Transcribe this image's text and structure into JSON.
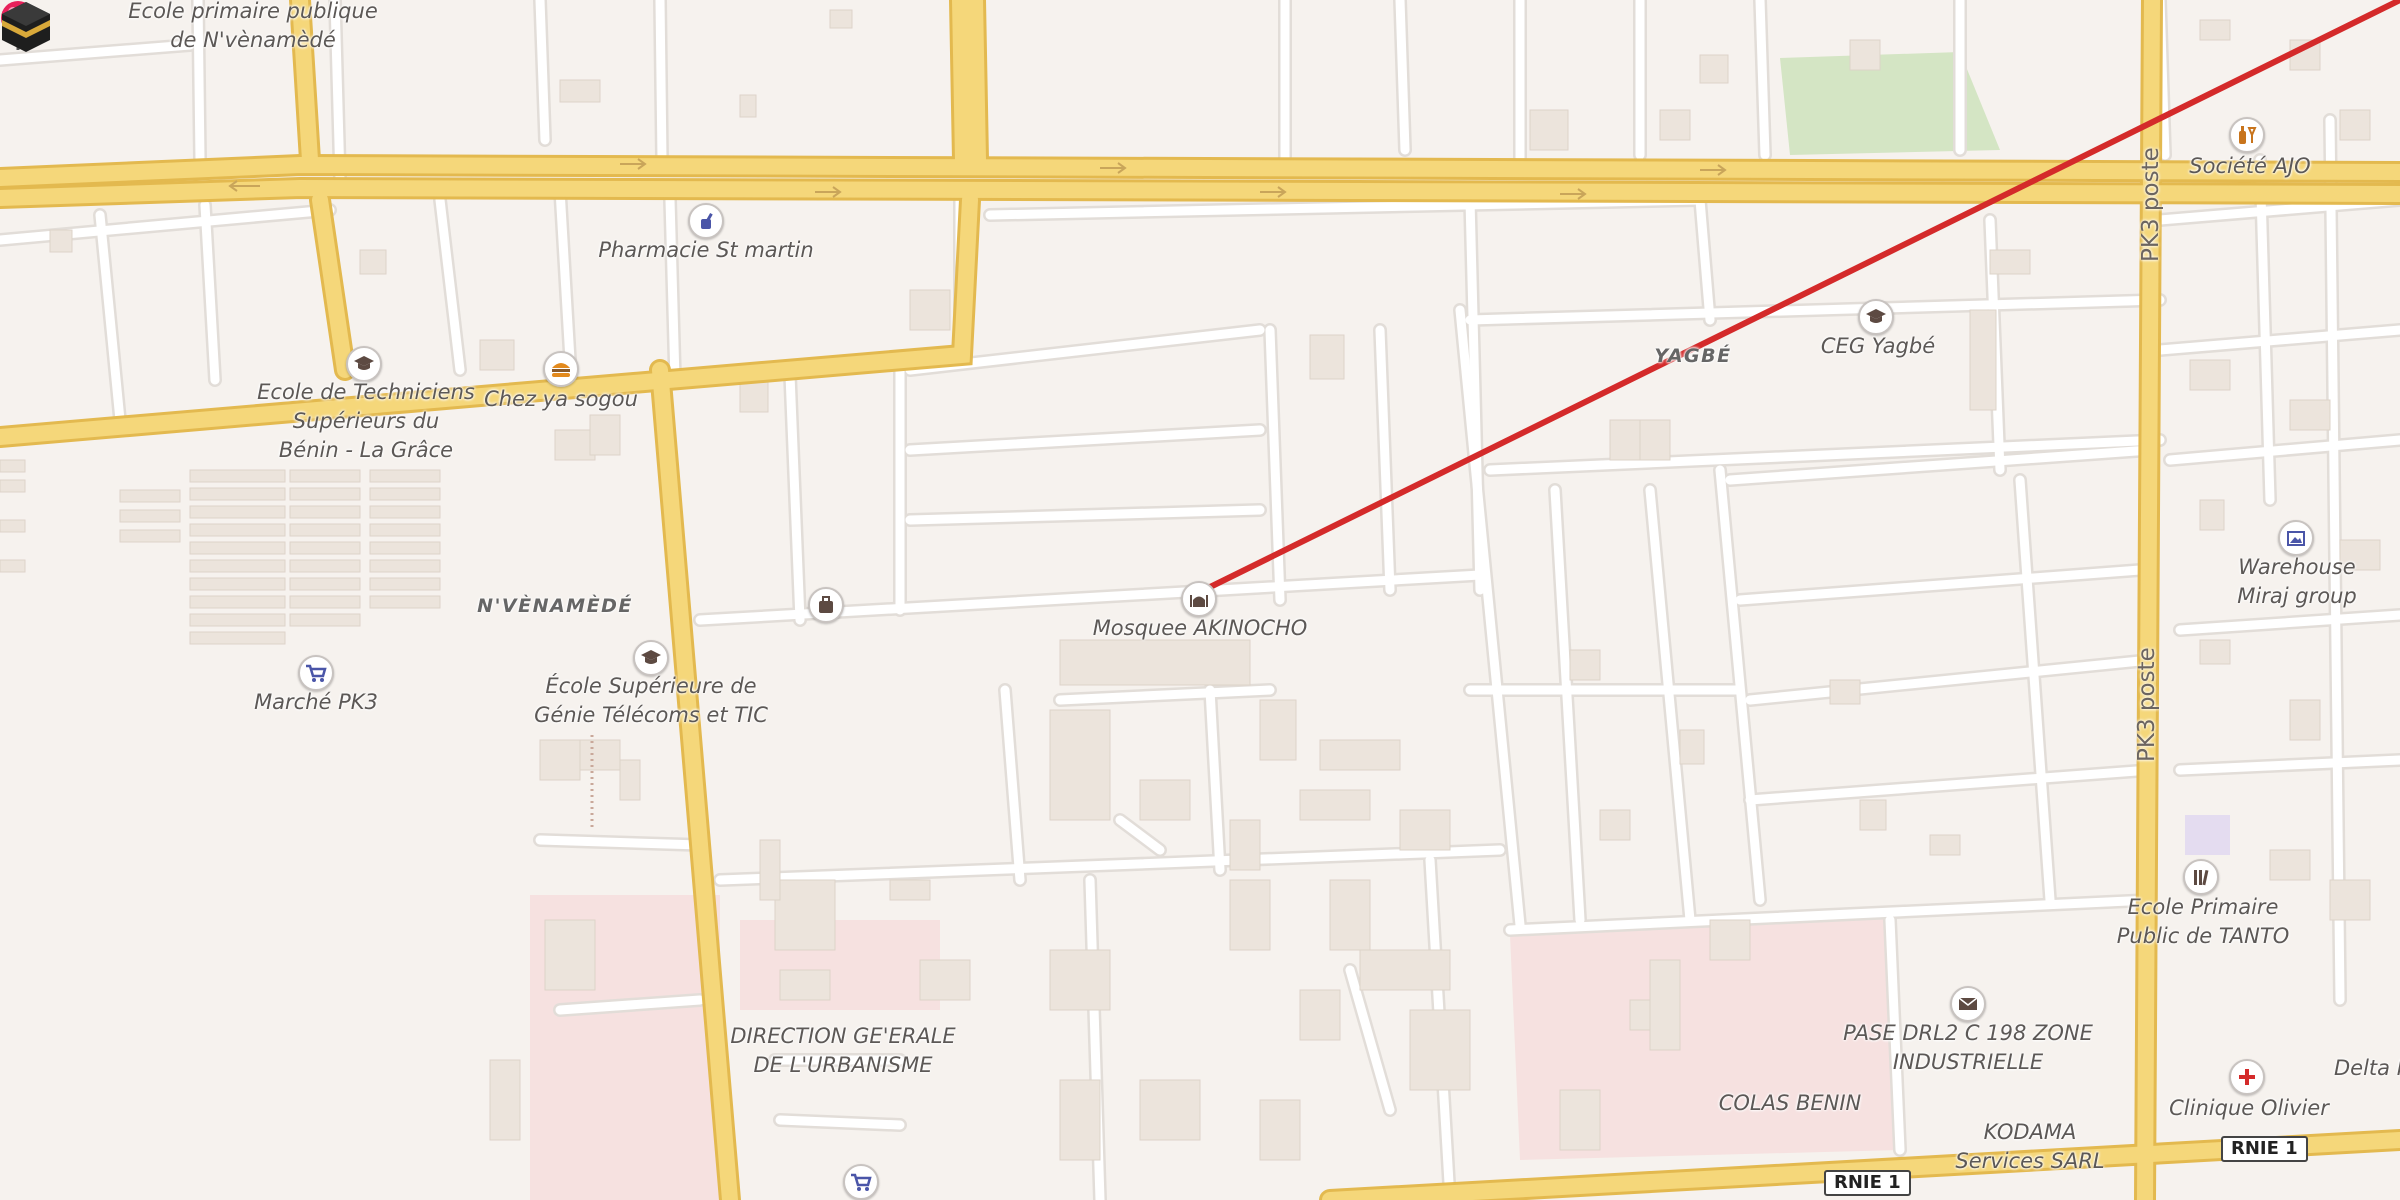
{
  "colors": {
    "background": "#f6f2ee",
    "road_major": "#f5d77a",
    "road_casing": "#e3b94f",
    "road_minor": "#ffffff",
    "building": "#ece4dc",
    "line": "#d42a2a",
    "pin": "#e8215b",
    "park": "#d4e5c4",
    "zone_red": "#f6e1e0"
  },
  "place_labels": [
    {
      "text": "Ecole primaire publique\nde N'vènamèdé"
    },
    {
      "text": "Pharmacie St martin"
    },
    {
      "text": "Ecole de Techniciens\nSupérieurs du\nBénin - La Grâce"
    },
    {
      "text": "Chez ya sogou"
    },
    {
      "text": "N'VÈNAMÈDÉ"
    },
    {
      "text": "École Supérieure de\nGénie Télécoms et TIC"
    },
    {
      "text": "Marché PK3"
    },
    {
      "text": "Mosquee AKINOCHO"
    },
    {
      "text": "YAGBÉ"
    },
    {
      "text": "CEG Yagbé"
    },
    {
      "text": "Société AJO"
    },
    {
      "text": "Warehouse\nMiraj group"
    },
    {
      "text": "Ecole Primaire\nPublic de TANTO"
    },
    {
      "text": "PASE DRL2 C 198 ZONE\nINDUSTRIELLE"
    },
    {
      "text": "COLAS BENIN"
    },
    {
      "text": "DIRECTION GE'ERALE\nDE L'URBANISME"
    },
    {
      "text": "Clinique Olivier"
    },
    {
      "text": "KODAMA\nServices SARL"
    },
    {
      "text": "Delta M"
    }
  ],
  "road_names": {
    "pk3_north": "PK3 poste",
    "pk3_south": "PK3 poste"
  },
  "shields": {
    "rnie1_a": "RNIE 1",
    "rnie1_b": "RNIE 1"
  },
  "icons": {
    "pharmacy": "pharmacy-icon",
    "school": "graduation-cap-icon",
    "fast_food": "burger-icon",
    "shop": "shopping-cart-icon",
    "luggage": "suitcase-icon",
    "mosque": "mosque-icon",
    "kaaba": "kaaba-icon",
    "liquor": "bottle-icon",
    "gallery": "picture-icon",
    "post": "mail-icon",
    "clinic": "red-cross-icon",
    "library": "books-icon",
    "pin": "location-pin-icon",
    "qibla_line": "qibla-direction-line"
  }
}
